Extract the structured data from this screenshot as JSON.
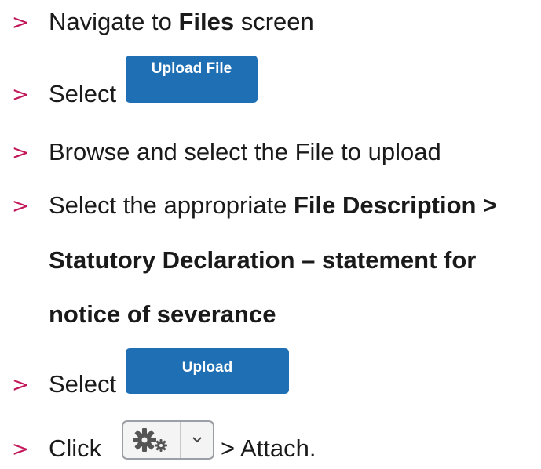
{
  "bullet_glyph": ">",
  "steps": [
    {
      "pre": "Navigate to ",
      "bold": "Files",
      "post": " screen"
    },
    {
      "text": "Select",
      "button": "Upload File"
    },
    {
      "text": "Browse and select the File to upload"
    },
    {
      "pre": "Select the appropriate ",
      "bold": "File Description >",
      "cont1": "Statutory Declaration – statement for",
      "cont2": "notice of severance"
    },
    {
      "text": "Select",
      "button": "Upload"
    },
    {
      "text": "Click",
      "post": "> Attach."
    }
  ],
  "colors": {
    "bullet": "#c2185b",
    "button_blue": "#1f6fb5"
  },
  "icons": {
    "gear": "gear-icon",
    "chevron": "chevron-down-icon"
  }
}
